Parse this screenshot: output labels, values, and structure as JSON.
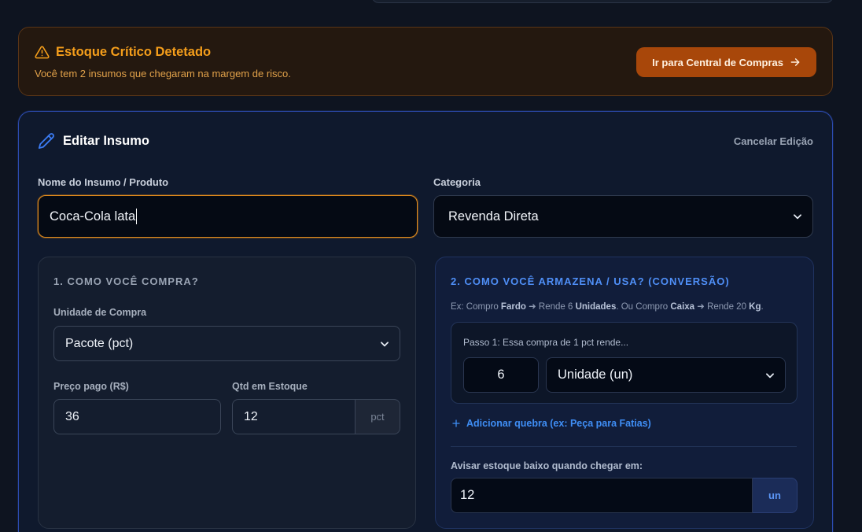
{
  "alert": {
    "title": "Estoque Crítico Detetado",
    "message": "Você tem 2 insumos que chegaram na margem de risco.",
    "button_label": "Ir para Central de Compras"
  },
  "edit": {
    "title": "Editar Insumo",
    "cancel_label": "Cancelar Edição",
    "name_label": "Nome do Insumo / Produto",
    "name_value": "Coca-Cola lata",
    "category_label": "Categoria",
    "category_value": "Revenda Direta"
  },
  "purchase": {
    "title": "1. COMO VOCÊ COMPRA?",
    "unit_label": "Unidade de Compra",
    "unit_value": "Pacote (pct)",
    "price_label": "Preço pago (R$)",
    "price_value": "36",
    "stock_label": "Qtd em Estoque",
    "stock_value": "12",
    "stock_suffix": "pct"
  },
  "storage": {
    "title": "2. COMO VOCÊ ARMAZENA / USA? (CONVERSÃO)",
    "hint_prefix": "Ex: Compro ",
    "hint_b1": "Fardo",
    "hint_mid1": " ➜ Rende 6 ",
    "hint_b2": "Unidades",
    "hint_mid2": ". Ou Compro ",
    "hint_b3": "Caixa",
    "hint_mid3": " ➜ Rende 20 ",
    "hint_b4": "Kg",
    "hint_end": ".",
    "step_label": "Passo 1: Essa compra de 1 pct rende...",
    "step_qty": "6",
    "step_unit": "Unidade (un)",
    "add_break_label": "Adicionar quebra (ex: Peça para Fatias)",
    "low_stock_label": "Avisar estoque baixo quando chegar em:",
    "low_stock_value": "12",
    "low_stock_suffix": "un"
  },
  "colors": {
    "alert_accent": "#f59e1b",
    "alert_button": "#a8470a",
    "focus_border": "#e08a1c",
    "section2_title": "#4f8ff7",
    "link": "#3f8ef5"
  },
  "icons": [
    "warning-icon",
    "arrow-right-icon",
    "pencil-icon",
    "chevron-down-icon",
    "plus-icon"
  ]
}
